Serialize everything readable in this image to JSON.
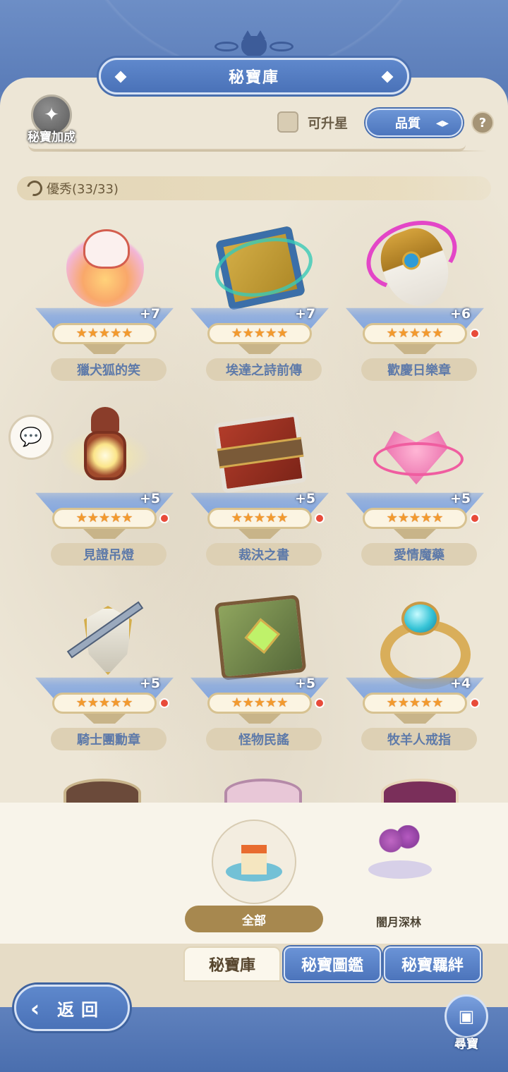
{
  "header": {
    "title": "秘寶庫",
    "bonus_label": "秘寶加成",
    "upgrade_label": "可升星",
    "sort_label": "品質",
    "help_icon": "?"
  },
  "section": {
    "title": "優秀(33/33)"
  },
  "items": [
    {
      "name": "獵犬狐的笑",
      "level": "+7",
      "stars": "★★★★★",
      "red_dot": false,
      "art": "fox-art"
    },
    {
      "name": "埃達之詩前傳",
      "level": "+7",
      "stars": "★★★★★",
      "red_dot": false,
      "art": "book-art"
    },
    {
      "name": "歡慶日樂章",
      "level": "+6",
      "stars": "★★★★★",
      "red_dot": true,
      "art": "horn-art"
    },
    {
      "name": "見證吊燈",
      "level": "+5",
      "stars": "★★★★★",
      "red_dot": true,
      "art": "lantern-art"
    },
    {
      "name": "裁決之書",
      "level": "+5",
      "stars": "★★★★★",
      "red_dot": true,
      "art": "book-art"
    },
    {
      "name": "愛情魔藥",
      "level": "+5",
      "stars": "★★★★★",
      "red_dot": true,
      "art": "potion-art"
    },
    {
      "name": "騎士團勳章",
      "level": "+5",
      "stars": "★★★★★",
      "red_dot": true,
      "art": "shield-art"
    },
    {
      "name": "怪物民謠",
      "level": "+5",
      "stars": "★★★★★",
      "red_dot": true,
      "art": "book-art"
    },
    {
      "name": "牧羊人戒指",
      "level": "+4",
      "stars": "★★★★★",
      "red_dot": true,
      "art": "ring-art"
    }
  ],
  "filters": {
    "all_label": "全部",
    "forest_label": "闇月深林"
  },
  "tabs": [
    {
      "label": "秘寶庫",
      "active": true
    },
    {
      "label": "秘寶圖鑑",
      "active": false
    },
    {
      "label": "秘寶羈絆",
      "active": false
    }
  ],
  "footer": {
    "back_label": "返回",
    "treasure_label": "尋寶"
  },
  "colors": {
    "accent_blue": "#5a7cb8",
    "parchment": "#ede6d6",
    "star_orange": "#f29a2e",
    "name_text": "#5e7aa9",
    "badge_red": "#e84b3a"
  }
}
